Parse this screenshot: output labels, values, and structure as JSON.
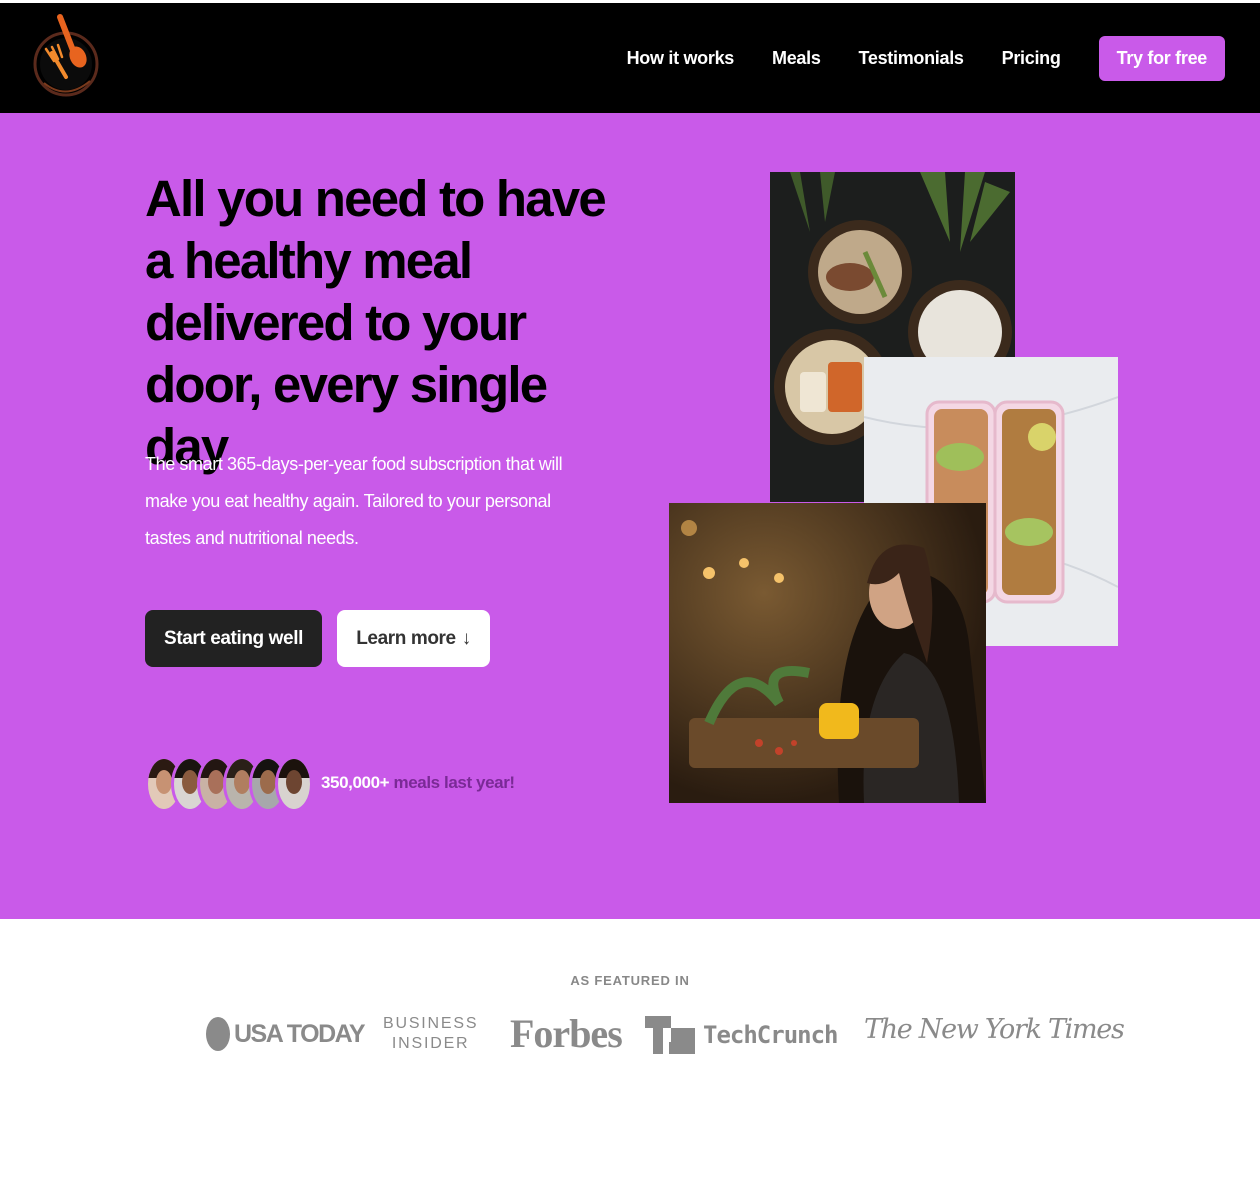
{
  "nav": {
    "links": [
      "How it works",
      "Meals",
      "Testimonials",
      "Pricing"
    ],
    "cta": "Try for free"
  },
  "hero": {
    "title": "All you need to have a healthy meal delivered to your door, every single day",
    "description": "The smart 365-days-per-year food subscription that will make you eat healthy again. Tailored to your personal tastes and nutritional needs.",
    "primary_button": "Start eating well",
    "secondary_button": "Learn more",
    "secondary_arrow": "↓",
    "stat_number": "350,000+",
    "stat_text": " meals last year!",
    "avatar_count": 6
  },
  "featured": {
    "label": "AS FEATURED IN",
    "logos": {
      "usa_today": "USA TODAY",
      "business_insider_1": "BUSINESS",
      "business_insider_2": "INSIDER",
      "forbes": "Forbes",
      "techcrunch": "TechCrunch",
      "nyt": "The New York Times"
    }
  },
  "colors": {
    "brand": "#c95ae9",
    "nav_bg": "#000000",
    "dark_button": "#222222"
  },
  "icons": [
    "logo-fork-icon",
    "arrow-down-icon"
  ]
}
